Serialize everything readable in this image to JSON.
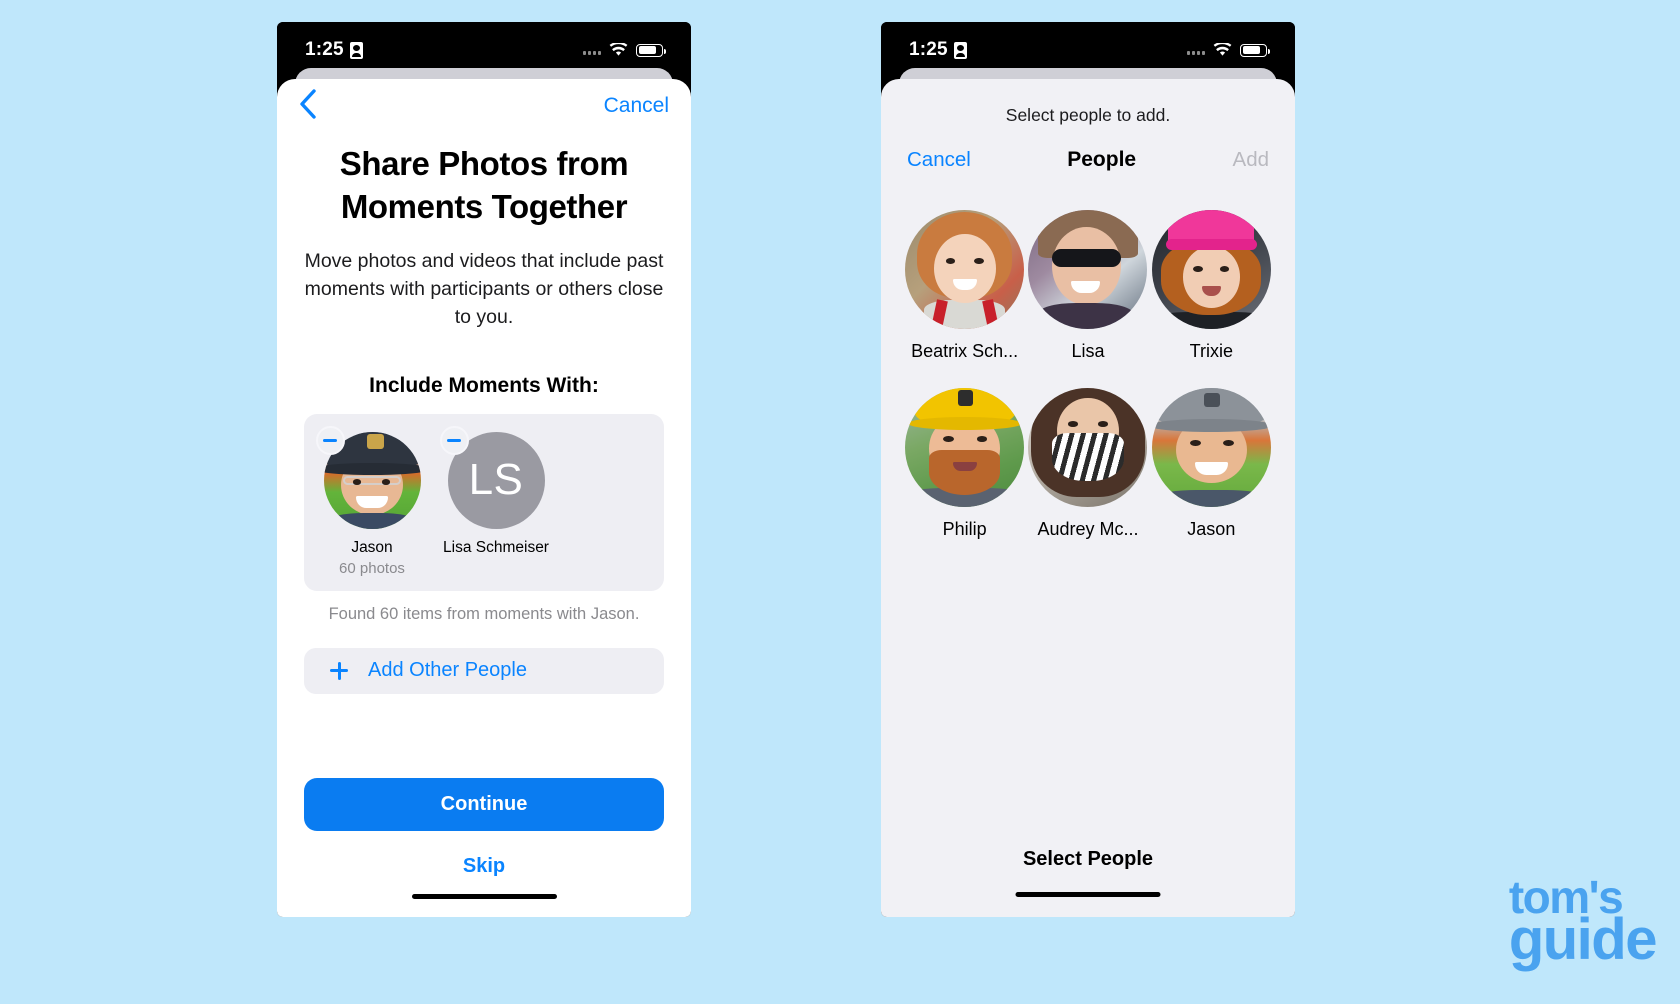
{
  "theme": {
    "page_background": "#bfe7fb",
    "accent_blue": "#0a84ff",
    "button_blue": "#0a7cf1",
    "sheet_gray": "#f1f1f5",
    "card_gray": "#eeeef3",
    "muted_text": "#8a8a8e",
    "disabled_text": "#b9b9bf",
    "logo_blue": "#4aa3ef"
  },
  "left_phone": {
    "status_bar": {
      "time": "1:25",
      "recording_icon": "screen-recording-icon",
      "signal_icon": "cellular-signal-icon",
      "wifi_icon": "wifi-icon",
      "battery_icon": "battery-icon"
    },
    "nav": {
      "back_icon": "back-chevron-icon",
      "cancel_label": "Cancel"
    },
    "headline": "Share Photos from Moments Together",
    "subcopy": "Move photos and videos that include past moments with participants or others close to you.",
    "section_title": "Include Moments With:",
    "included_people": [
      {
        "name": "Jason",
        "subtitle": "60 photos",
        "avatar_type": "photo",
        "remove_icon": "minus-badge-icon"
      },
      {
        "name": "Lisa Schmeiser",
        "subtitle": "",
        "avatar_type": "initials",
        "initials": "LS",
        "remove_icon": "minus-badge-icon"
      }
    ],
    "found_note": "Found 60 items from moments with Jason.",
    "add_other_people": {
      "icon": "plus-icon",
      "label": "Add Other People"
    },
    "primary_button": "Continue",
    "secondary_button": "Skip"
  },
  "right_phone": {
    "status_bar": {
      "time": "1:25",
      "recording_icon": "screen-recording-icon",
      "signal_icon": "cellular-signal-icon",
      "wifi_icon": "wifi-icon",
      "battery_icon": "battery-icon"
    },
    "sheet_caption": "Select people to add.",
    "modal": {
      "cancel_label": "Cancel",
      "title": "People",
      "add_label": "Add"
    },
    "people": [
      {
        "name": "Beatrix Sch...",
        "avatar_type": "photo"
      },
      {
        "name": "Lisa",
        "avatar_type": "photo"
      },
      {
        "name": "Trixie",
        "avatar_type": "photo"
      },
      {
        "name": "Philip",
        "avatar_type": "photo"
      },
      {
        "name": "Audrey Mc...",
        "avatar_type": "photo"
      },
      {
        "name": "Jason",
        "avatar_type": "photo"
      }
    ],
    "bottom_label": "Select People"
  },
  "watermark": {
    "line1": "tom's",
    "line2": "guide"
  }
}
